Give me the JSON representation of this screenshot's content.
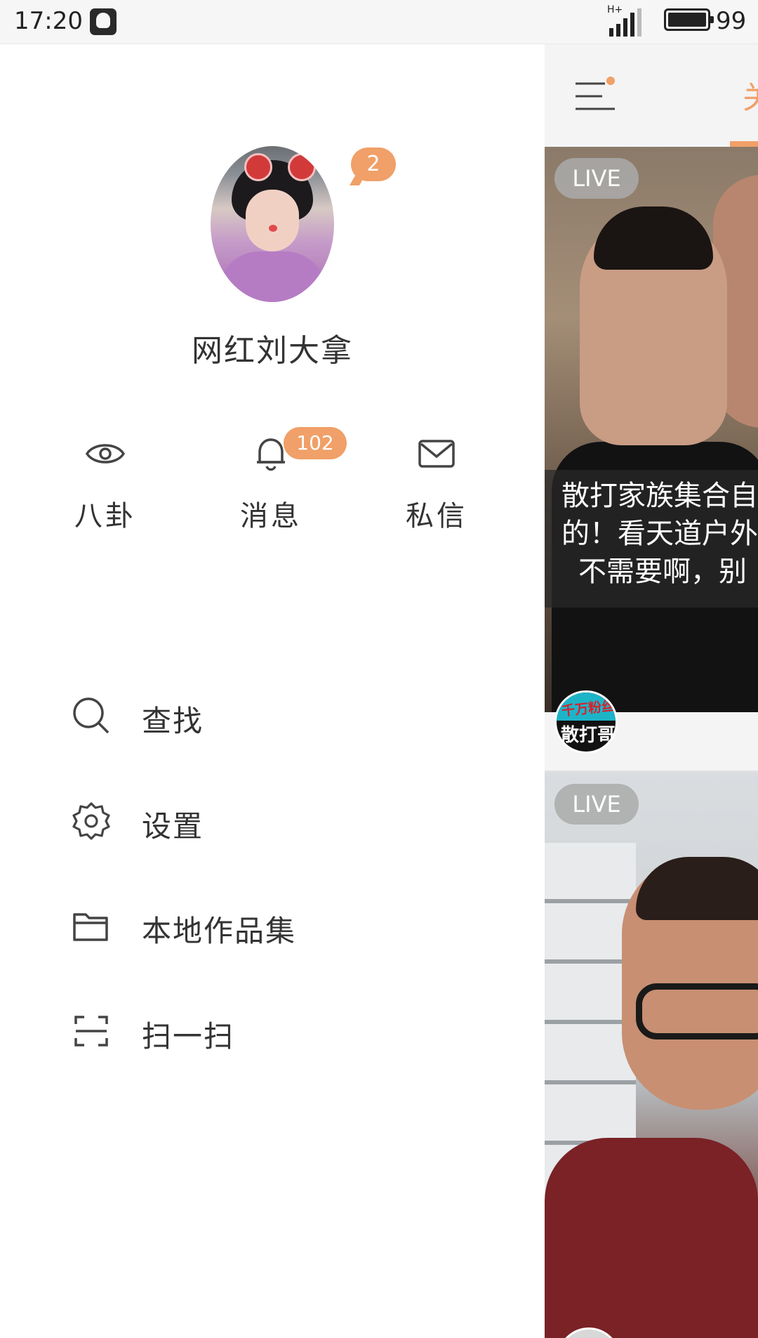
{
  "status_bar": {
    "time": "17:20",
    "network_type": "H+",
    "battery_level": "99"
  },
  "drawer": {
    "profile": {
      "username": "网红刘大拿",
      "notification_count": "2"
    },
    "quick_actions": [
      {
        "label": "八卦",
        "icon": "eye-icon"
      },
      {
        "label": "消息",
        "icon": "bell-icon",
        "badge": "102"
      },
      {
        "label": "私信",
        "icon": "mail-icon"
      }
    ],
    "menu": [
      {
        "label": "查找",
        "icon": "search-icon"
      },
      {
        "label": "设置",
        "icon": "gear-icon"
      },
      {
        "label": "本地作品集",
        "icon": "folder-icon"
      },
      {
        "label": "扫一扫",
        "icon": "scan-icon"
      }
    ]
  },
  "main_panel": {
    "active_tab_partial": "关",
    "feed": [
      {
        "badge": "LIVE",
        "caption_lines": [
          "散打家族集合自",
          "的！看天道户外",
          "不需要啊，别"
        ],
        "streamer_logo_text_top": "千万粉丝",
        "streamer_logo_text": "散打哥"
      },
      {
        "badge": "LIVE"
      }
    ]
  },
  "colors": {
    "accent": "#f0a068",
    "text": "#333333",
    "background": "#ffffff",
    "panel_background": "#f4f4f4"
  }
}
